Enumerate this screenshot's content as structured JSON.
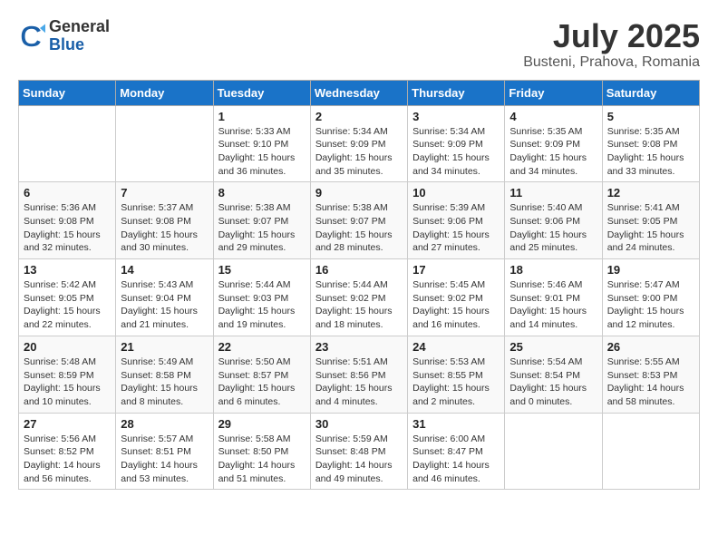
{
  "logo": {
    "general": "General",
    "blue": "Blue"
  },
  "header": {
    "month": "July 2025",
    "location": "Busteni, Prahova, Romania"
  },
  "weekdays": [
    "Sunday",
    "Monday",
    "Tuesday",
    "Wednesday",
    "Thursday",
    "Friday",
    "Saturday"
  ],
  "weeks": [
    [
      {
        "day": "",
        "detail": ""
      },
      {
        "day": "",
        "detail": ""
      },
      {
        "day": "1",
        "detail": "Sunrise: 5:33 AM\nSunset: 9:10 PM\nDaylight: 15 hours and 36 minutes."
      },
      {
        "day": "2",
        "detail": "Sunrise: 5:34 AM\nSunset: 9:09 PM\nDaylight: 15 hours and 35 minutes."
      },
      {
        "day": "3",
        "detail": "Sunrise: 5:34 AM\nSunset: 9:09 PM\nDaylight: 15 hours and 34 minutes."
      },
      {
        "day": "4",
        "detail": "Sunrise: 5:35 AM\nSunset: 9:09 PM\nDaylight: 15 hours and 34 minutes."
      },
      {
        "day": "5",
        "detail": "Sunrise: 5:35 AM\nSunset: 9:08 PM\nDaylight: 15 hours and 33 minutes."
      }
    ],
    [
      {
        "day": "6",
        "detail": "Sunrise: 5:36 AM\nSunset: 9:08 PM\nDaylight: 15 hours and 32 minutes."
      },
      {
        "day": "7",
        "detail": "Sunrise: 5:37 AM\nSunset: 9:08 PM\nDaylight: 15 hours and 30 minutes."
      },
      {
        "day": "8",
        "detail": "Sunrise: 5:38 AM\nSunset: 9:07 PM\nDaylight: 15 hours and 29 minutes."
      },
      {
        "day": "9",
        "detail": "Sunrise: 5:38 AM\nSunset: 9:07 PM\nDaylight: 15 hours and 28 minutes."
      },
      {
        "day": "10",
        "detail": "Sunrise: 5:39 AM\nSunset: 9:06 PM\nDaylight: 15 hours and 27 minutes."
      },
      {
        "day": "11",
        "detail": "Sunrise: 5:40 AM\nSunset: 9:06 PM\nDaylight: 15 hours and 25 minutes."
      },
      {
        "day": "12",
        "detail": "Sunrise: 5:41 AM\nSunset: 9:05 PM\nDaylight: 15 hours and 24 minutes."
      }
    ],
    [
      {
        "day": "13",
        "detail": "Sunrise: 5:42 AM\nSunset: 9:05 PM\nDaylight: 15 hours and 22 minutes."
      },
      {
        "day": "14",
        "detail": "Sunrise: 5:43 AM\nSunset: 9:04 PM\nDaylight: 15 hours and 21 minutes."
      },
      {
        "day": "15",
        "detail": "Sunrise: 5:44 AM\nSunset: 9:03 PM\nDaylight: 15 hours and 19 minutes."
      },
      {
        "day": "16",
        "detail": "Sunrise: 5:44 AM\nSunset: 9:02 PM\nDaylight: 15 hours and 18 minutes."
      },
      {
        "day": "17",
        "detail": "Sunrise: 5:45 AM\nSunset: 9:02 PM\nDaylight: 15 hours and 16 minutes."
      },
      {
        "day": "18",
        "detail": "Sunrise: 5:46 AM\nSunset: 9:01 PM\nDaylight: 15 hours and 14 minutes."
      },
      {
        "day": "19",
        "detail": "Sunrise: 5:47 AM\nSunset: 9:00 PM\nDaylight: 15 hours and 12 minutes."
      }
    ],
    [
      {
        "day": "20",
        "detail": "Sunrise: 5:48 AM\nSunset: 8:59 PM\nDaylight: 15 hours and 10 minutes."
      },
      {
        "day": "21",
        "detail": "Sunrise: 5:49 AM\nSunset: 8:58 PM\nDaylight: 15 hours and 8 minutes."
      },
      {
        "day": "22",
        "detail": "Sunrise: 5:50 AM\nSunset: 8:57 PM\nDaylight: 15 hours and 6 minutes."
      },
      {
        "day": "23",
        "detail": "Sunrise: 5:51 AM\nSunset: 8:56 PM\nDaylight: 15 hours and 4 minutes."
      },
      {
        "day": "24",
        "detail": "Sunrise: 5:53 AM\nSunset: 8:55 PM\nDaylight: 15 hours and 2 minutes."
      },
      {
        "day": "25",
        "detail": "Sunrise: 5:54 AM\nSunset: 8:54 PM\nDaylight: 15 hours and 0 minutes."
      },
      {
        "day": "26",
        "detail": "Sunrise: 5:55 AM\nSunset: 8:53 PM\nDaylight: 14 hours and 58 minutes."
      }
    ],
    [
      {
        "day": "27",
        "detail": "Sunrise: 5:56 AM\nSunset: 8:52 PM\nDaylight: 14 hours and 56 minutes."
      },
      {
        "day": "28",
        "detail": "Sunrise: 5:57 AM\nSunset: 8:51 PM\nDaylight: 14 hours and 53 minutes."
      },
      {
        "day": "29",
        "detail": "Sunrise: 5:58 AM\nSunset: 8:50 PM\nDaylight: 14 hours and 51 minutes."
      },
      {
        "day": "30",
        "detail": "Sunrise: 5:59 AM\nSunset: 8:48 PM\nDaylight: 14 hours and 49 minutes."
      },
      {
        "day": "31",
        "detail": "Sunrise: 6:00 AM\nSunset: 8:47 PM\nDaylight: 14 hours and 46 minutes."
      },
      {
        "day": "",
        "detail": ""
      },
      {
        "day": "",
        "detail": ""
      }
    ]
  ]
}
